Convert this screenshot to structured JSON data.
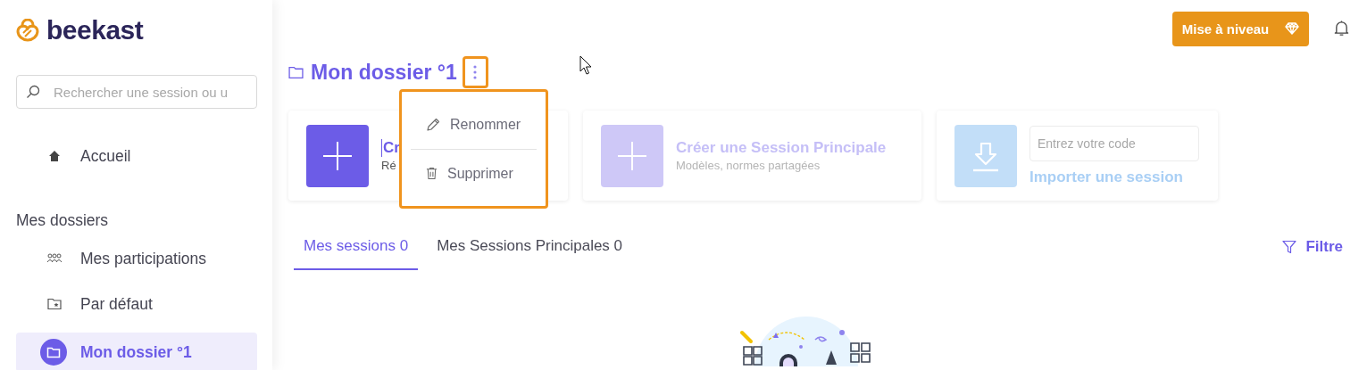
{
  "logo": {
    "text": "beekast"
  },
  "search": {
    "placeholder": "Rechercher une session ou u"
  },
  "nav": [
    {
      "label": "Accueil",
      "kind": "home",
      "selected": false
    }
  ],
  "folders_heading": "Mes dossiers",
  "folders": [
    {
      "label": "Mes participations",
      "kind": "participations",
      "selected": false
    },
    {
      "label": "Par défaut",
      "kind": "default",
      "selected": false
    },
    {
      "label": "Mon dossier °1",
      "kind": "folder",
      "selected": true
    }
  ],
  "upgrade_button": {
    "label": "Mise à niveau"
  },
  "title": "Mon dossier °1",
  "menu": {
    "items": [
      {
        "label": "Renommer",
        "kind": "rename"
      },
      {
        "label": "Supprimer",
        "kind": "delete"
      }
    ]
  },
  "cards": [
    {
      "kind": "create",
      "title": "Cr",
      "subtitle": "Ré",
      "disabled": false
    },
    {
      "kind": "create",
      "title": "Créer une Session Principale",
      "subtitle": "Modèles, normes partagées",
      "disabled": true
    },
    {
      "kind": "import",
      "placeholder": "Entrez votre code",
      "title": "Importer une session",
      "disabled": true
    }
  ],
  "tabs": [
    {
      "label": "Mes sessions 0",
      "selected": true
    },
    {
      "label": "Mes Sessions Principales 0",
      "selected": false
    }
  ],
  "filter": {
    "label": "Filtre"
  }
}
